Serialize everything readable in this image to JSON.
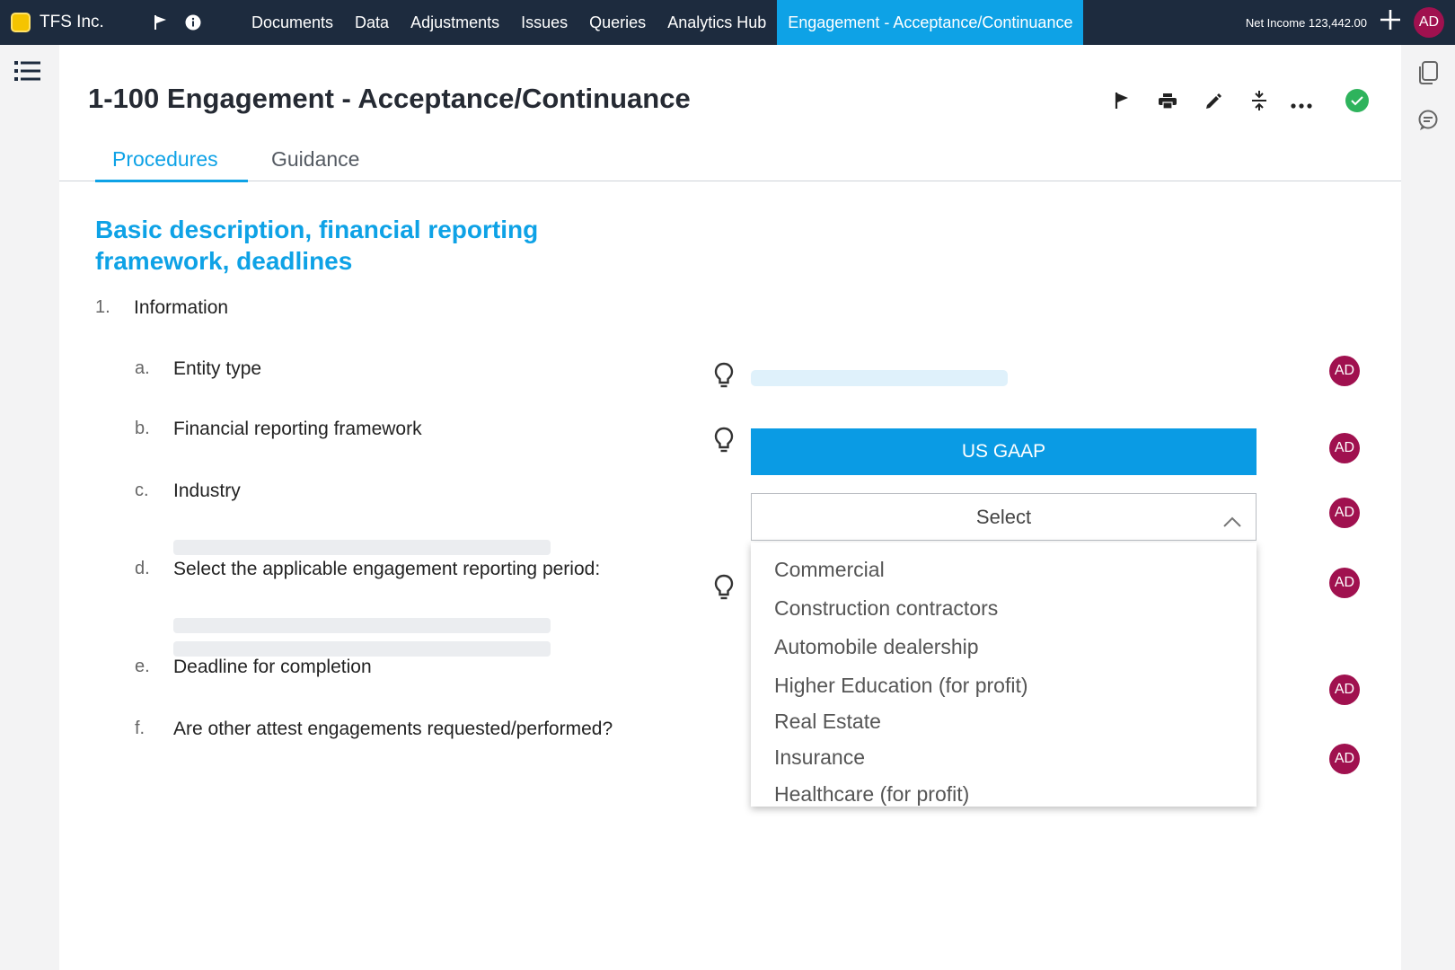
{
  "app": {
    "company": "TFS Inc.",
    "brand_color": "#f5c400"
  },
  "nav": {
    "items": [
      "Documents",
      "Data",
      "Adjustments",
      "Issues",
      "Queries",
      "Analytics Hub",
      "Engagement - Acceptance/Continuance"
    ],
    "active": "Engagement - Acceptance/Continuance",
    "active_color": "#0ea2e6"
  },
  "header": {
    "net_income": "Net Income 123,442.00",
    "user_initials": "AD"
  },
  "page": {
    "title": "1-100 Engagement - Acceptance/Continuance",
    "tabs": [
      "Procedures",
      "Guidance"
    ],
    "active_tab": "Procedures",
    "section_title": "Basic description, financial reporting framework, deadlines"
  },
  "procedure": {
    "number": "1.",
    "label": "Information",
    "items": [
      {
        "letter": "a.",
        "label": "Entity type"
      },
      {
        "letter": "b.",
        "label": "Financial reporting framework"
      },
      {
        "letter": "c.",
        "label": "Industry"
      },
      {
        "letter": "d.",
        "label": "Select the applicable engagement reporting period:"
      },
      {
        "letter": "e.",
        "label": "Deadline for completion"
      },
      {
        "letter": "f.",
        "label": "Are other attest engagements requested/performed?"
      }
    ]
  },
  "framework_button": "US GAAP",
  "industry_select": {
    "placeholder": "Select",
    "options": [
      "Commercial",
      "Construction contractors",
      "Automobile dealership",
      "Higher Education (for profit)",
      "Real Estate",
      "Insurance",
      "Healthcare (for profit)"
    ]
  },
  "signoff_initials": "AD",
  "colors": {
    "topbar": "#1d2b3e",
    "accent": "#0ea2e6",
    "avatar": "#a0114f",
    "complete": "#2eb35c"
  },
  "icons": {
    "flag": "flag-icon",
    "info": "info-icon",
    "print": "printer-icon",
    "edit": "pencil-icon",
    "collapse": "collapse-icon",
    "more": "more-icon",
    "complete": "check-circle-icon",
    "hint": "lightbulb-icon",
    "menu": "list-icon",
    "copy": "copy-icon",
    "comment": "comment-icon"
  }
}
